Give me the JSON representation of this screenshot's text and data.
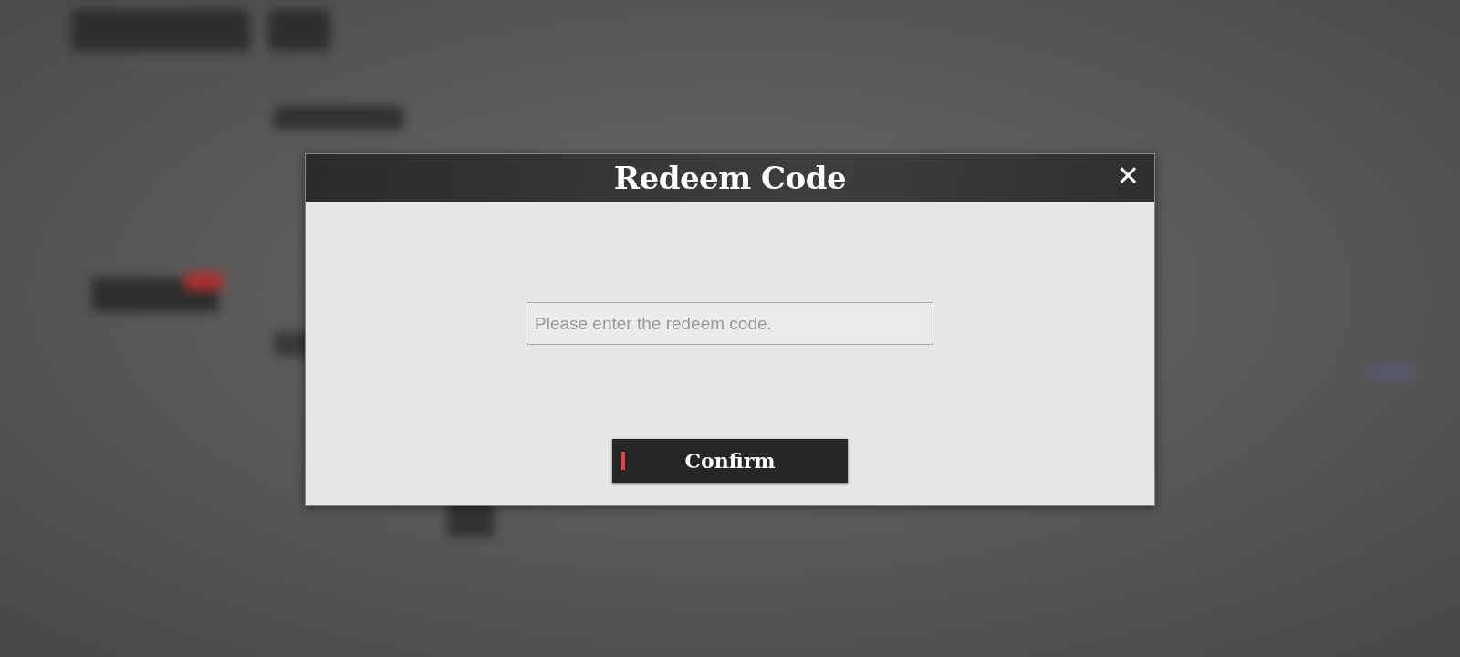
{
  "dialog": {
    "title": "Redeem Code",
    "close_label": "✕",
    "code_field": {
      "placeholder": "Please enter the redeem code."
    },
    "confirm_button": "Confirm"
  }
}
